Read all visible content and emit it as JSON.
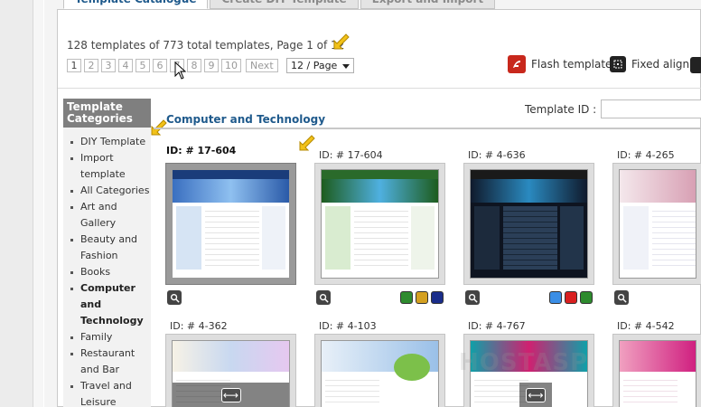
{
  "tabs": [
    {
      "label": "Template Catalogue",
      "active": true
    },
    {
      "label": "Create DIY Template",
      "active": false
    },
    {
      "label": "Export and Import",
      "active": false
    }
  ],
  "summary": "128 templates of 773 total templates, Page 1 of 12",
  "pager": {
    "pages": [
      "1",
      "2",
      "3",
      "4",
      "5",
      "6",
      "7",
      "8",
      "9",
      "10"
    ],
    "next_label": "Next",
    "per_page": "12 / Page"
  },
  "options": {
    "flash_label": "Flash template",
    "fixed_label": "Fixed align"
  },
  "sidebar": {
    "title_line1": "Template",
    "title_line2": "Categories",
    "items": [
      {
        "label": "DIY Template"
      },
      {
        "label": "Import template"
      },
      {
        "label": "All Categories"
      },
      {
        "label": "Art and Gallery"
      },
      {
        "label": "Beauty and Fashion"
      },
      {
        "label": "Books"
      },
      {
        "label": "Computer and Technology",
        "active": true
      },
      {
        "label": "Family"
      },
      {
        "label": "Restaurant and Bar"
      },
      {
        "label": "Travel and Leisure"
      }
    ]
  },
  "main": {
    "section_title": "Computer and Technology",
    "template_id_label": "Template ID :",
    "template_id_value": ""
  },
  "cards": [
    {
      "id": "ID: # 17-604",
      "selected": true,
      "swatches": []
    },
    {
      "id": "ID: # 17-604",
      "selected": false,
      "swatches": [
        "#2e8b2e",
        "#d4a020",
        "#1a2d8a"
      ]
    },
    {
      "id": "ID: # 4-636",
      "selected": false,
      "swatches": [
        "#3a8ee6",
        "#d92020",
        "#2e8b2e"
      ]
    },
    {
      "id": "ID: # 4-265",
      "selected": false,
      "swatches": []
    },
    {
      "id": "ID: # 4-362",
      "selected": false,
      "swatches": []
    },
    {
      "id": "ID: # 4-103",
      "selected": false,
      "swatches": []
    },
    {
      "id": "ID: # 4-767",
      "selected": false,
      "swatches": []
    },
    {
      "id": "ID: # 4-542",
      "selected": false,
      "swatches": []
    }
  ],
  "colors": {
    "accent": "#1f5a8c",
    "sidebar_header": "#7f7f7f",
    "flash_icon": "#c8281c"
  },
  "icons": [
    "pointer-arrow-icon",
    "mouse-cursor-icon",
    "flash-icon",
    "fixed-align-icon",
    "magnify-icon",
    "expand-arrows-icon"
  ]
}
